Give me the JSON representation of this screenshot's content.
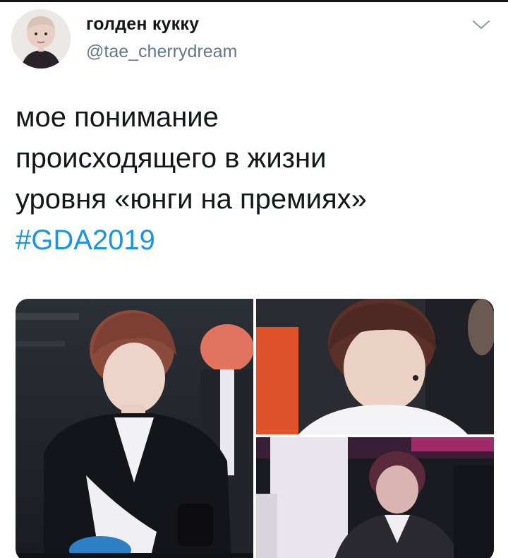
{
  "author": {
    "display_name": "голден кукку",
    "handle": "@tae_cherrydream"
  },
  "tweet": {
    "lines": [
      "мое понимание",
      "происходящего в жизни",
      "уровня «юнги на премиях»"
    ],
    "hashtag": "#GDA2019"
  },
  "icons": {
    "menu": "chevron-down-icon"
  },
  "colors": {
    "text": "#14171a",
    "secondary": "#657786",
    "link": "#1b95e0"
  }
}
